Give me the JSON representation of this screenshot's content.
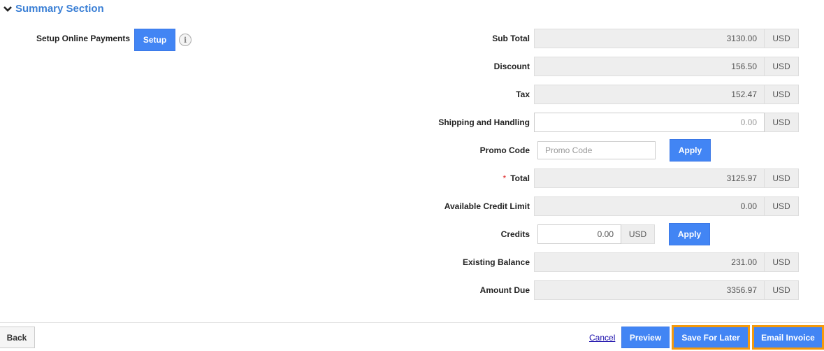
{
  "section": {
    "title": "Summary Section",
    "toggle_icon": "chevron-down-icon"
  },
  "online_payments": {
    "label": "Setup Online Payments",
    "button_label": "Setup",
    "info_icon": "i"
  },
  "summary": {
    "sub_total": {
      "label": "Sub Total",
      "value": "3130.00",
      "currency": "USD"
    },
    "discount": {
      "label": "Discount",
      "value": "156.50",
      "currency": "USD"
    },
    "tax": {
      "label": "Tax",
      "value": "152.47",
      "currency": "USD"
    },
    "shipping": {
      "label": "Shipping and Handling",
      "value": "0.00",
      "currency": "USD"
    },
    "promo": {
      "label": "Promo Code",
      "placeholder": "Promo Code",
      "value": "",
      "button_label": "Apply"
    },
    "total": {
      "label": "Total",
      "required_mark": "*",
      "value": "3125.97",
      "currency": "USD"
    },
    "credit_limit": {
      "label": "Available Credit Limit",
      "value": "0.00",
      "currency": "USD"
    },
    "credits": {
      "label": "Credits",
      "value": "0.00",
      "currency": "USD",
      "button_label": "Apply"
    },
    "existing_balance": {
      "label": "Existing Balance",
      "value": "231.00",
      "currency": "USD"
    },
    "amount_due": {
      "label": "Amount Due",
      "value": "3356.97",
      "currency": "USD"
    }
  },
  "footer": {
    "back_label": "Back",
    "cancel_label": "Cancel",
    "preview_label": "Preview",
    "save_label": "Save For Later",
    "email_label": "Email Invoice"
  },
  "colors": {
    "accent": "#4285f4",
    "section_title": "#3a7fd5",
    "highlight_outline": "#f59a0c"
  }
}
